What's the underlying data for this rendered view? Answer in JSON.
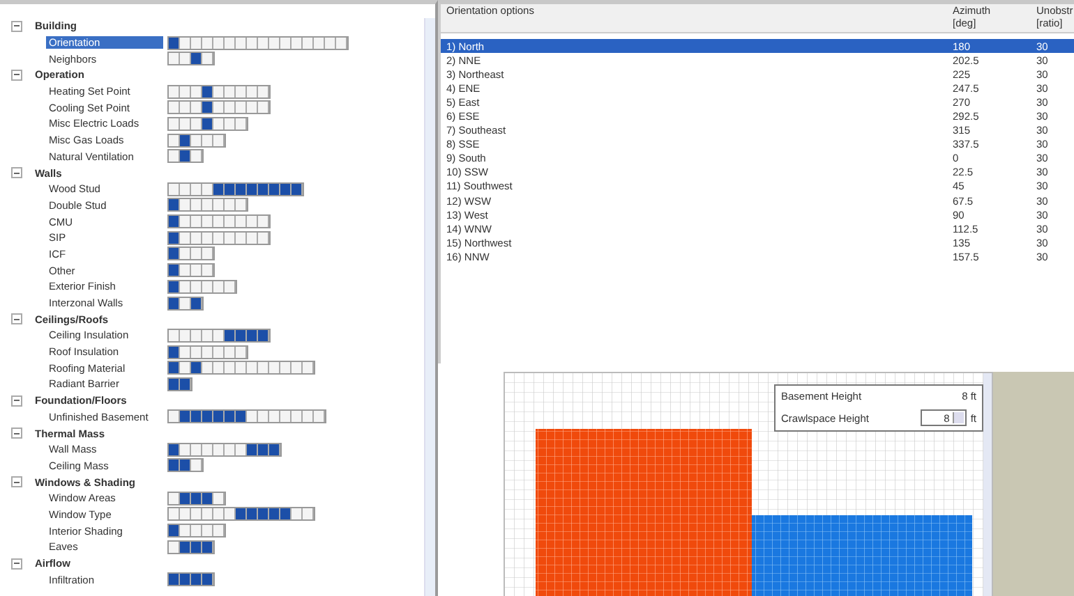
{
  "tree": {
    "groups": [
      {
        "label": "Building",
        "expanded": true,
        "items": [
          {
            "label": "Orientation",
            "selected": true,
            "options": [
              {
                "selected": true
              },
              {
                "selected": false
              },
              {
                "selected": false
              },
              {
                "selected": false
              },
              {
                "selected": false
              },
              {
                "selected": false
              },
              {
                "selected": false
              },
              {
                "selected": false
              },
              {
                "selected": false
              },
              {
                "selected": false
              },
              {
                "selected": false
              },
              {
                "selected": false
              },
              {
                "selected": false
              },
              {
                "selected": false
              },
              {
                "selected": false
              },
              {
                "selected": false
              }
            ]
          },
          {
            "label": "Neighbors",
            "selected": false,
            "options": [
              {
                "selected": false
              },
              {
                "selected": false
              },
              {
                "selected": true
              },
              {
                "selected": false
              }
            ]
          }
        ]
      },
      {
        "label": "Operation",
        "expanded": true,
        "items": [
          {
            "label": "Heating Set Point",
            "selected": false,
            "options": [
              {
                "selected": false
              },
              {
                "selected": false
              },
              {
                "selected": false
              },
              {
                "selected": true
              },
              {
                "selected": false
              },
              {
                "selected": false
              },
              {
                "selected": false
              },
              {
                "selected": false
              },
              {
                "selected": false
              }
            ]
          },
          {
            "label": "Cooling Set Point",
            "selected": false,
            "options": [
              {
                "selected": false
              },
              {
                "selected": false
              },
              {
                "selected": false
              },
              {
                "selected": true
              },
              {
                "selected": false
              },
              {
                "selected": false
              },
              {
                "selected": false
              },
              {
                "selected": false
              },
              {
                "selected": false
              }
            ]
          },
          {
            "label": "Misc Electric Loads",
            "selected": false,
            "options": [
              {
                "selected": false
              },
              {
                "selected": false
              },
              {
                "selected": false
              },
              {
                "selected": true
              },
              {
                "selected": false
              },
              {
                "selected": false
              },
              {
                "selected": false
              }
            ]
          },
          {
            "label": "Misc Gas Loads",
            "selected": false,
            "options": [
              {
                "selected": false
              },
              {
                "selected": true
              },
              {
                "selected": false
              },
              {
                "selected": false
              },
              {
                "selected": false
              }
            ]
          },
          {
            "label": "Natural Ventilation",
            "selected": false,
            "options": [
              {
                "selected": false
              },
              {
                "selected": true
              },
              {
                "selected": false
              }
            ]
          }
        ]
      },
      {
        "label": "Walls",
        "expanded": true,
        "items": [
          {
            "label": "Wood Stud",
            "selected": false,
            "options": [
              {
                "selected": false
              },
              {
                "selected": false
              },
              {
                "selected": false
              },
              {
                "selected": false
              },
              {
                "selected": true
              },
              {
                "selected": true
              },
              {
                "selected": true
              },
              {
                "selected": true
              },
              {
                "selected": true
              },
              {
                "selected": true
              },
              {
                "selected": true
              },
              {
                "selected": true
              }
            ]
          },
          {
            "label": "Double Stud",
            "selected": false,
            "options": [
              {
                "selected": true
              },
              {
                "selected": false
              },
              {
                "selected": false
              },
              {
                "selected": false
              },
              {
                "selected": false
              },
              {
                "selected": false
              },
              {
                "selected": false
              }
            ]
          },
          {
            "label": "CMU",
            "selected": false,
            "options": [
              {
                "selected": true
              },
              {
                "selected": false
              },
              {
                "selected": false
              },
              {
                "selected": false
              },
              {
                "selected": false
              },
              {
                "selected": false
              },
              {
                "selected": false
              },
              {
                "selected": false
              },
              {
                "selected": false
              }
            ]
          },
          {
            "label": "SIP",
            "selected": false,
            "options": [
              {
                "selected": true
              },
              {
                "selected": false
              },
              {
                "selected": false
              },
              {
                "selected": false
              },
              {
                "selected": false
              },
              {
                "selected": false
              },
              {
                "selected": false
              },
              {
                "selected": false
              },
              {
                "selected": false
              }
            ]
          },
          {
            "label": "ICF",
            "selected": false,
            "options": [
              {
                "selected": true
              },
              {
                "selected": false
              },
              {
                "selected": false
              },
              {
                "selected": false
              }
            ]
          },
          {
            "label": "Other",
            "selected": false,
            "options": [
              {
                "selected": true
              },
              {
                "selected": false
              },
              {
                "selected": false
              },
              {
                "selected": false
              }
            ]
          },
          {
            "label": "Exterior Finish",
            "selected": false,
            "options": [
              {
                "selected": true
              },
              {
                "selected": false
              },
              {
                "selected": false
              },
              {
                "selected": false
              },
              {
                "selected": false
              },
              {
                "selected": false
              }
            ]
          },
          {
            "label": "Interzonal Walls",
            "selected": false,
            "options": [
              {
                "selected": true
              },
              {
                "selected": false
              },
              {
                "selected": true
              }
            ]
          }
        ]
      },
      {
        "label": "Ceilings/Roofs",
        "expanded": true,
        "items": [
          {
            "label": "Ceiling Insulation",
            "selected": false,
            "options": [
              {
                "selected": false
              },
              {
                "selected": false
              },
              {
                "selected": false
              },
              {
                "selected": false
              },
              {
                "selected": false
              },
              {
                "selected": true
              },
              {
                "selected": true
              },
              {
                "selected": true
              },
              {
                "selected": true
              }
            ]
          },
          {
            "label": "Roof Insulation",
            "selected": false,
            "options": [
              {
                "selected": true
              },
              {
                "selected": false
              },
              {
                "selected": false
              },
              {
                "selected": false
              },
              {
                "selected": false
              },
              {
                "selected": false
              },
              {
                "selected": false
              }
            ]
          },
          {
            "label": "Roofing Material",
            "selected": false,
            "options": [
              {
                "selected": true
              },
              {
                "selected": false
              },
              {
                "selected": true
              },
              {
                "selected": false
              },
              {
                "selected": false
              },
              {
                "selected": false
              },
              {
                "selected": false
              },
              {
                "selected": false
              },
              {
                "selected": false
              },
              {
                "selected": false
              },
              {
                "selected": false
              },
              {
                "selected": false
              },
              {
                "selected": false
              }
            ]
          },
          {
            "label": "Radiant Barrier",
            "selected": false,
            "options": [
              {
                "selected": true
              },
              {
                "selected": true
              }
            ]
          }
        ]
      },
      {
        "label": "Foundation/Floors",
        "expanded": true,
        "items": [
          {
            "label": "Unfinished Basement",
            "selected": false,
            "options": [
              {
                "selected": false
              },
              {
                "selected": true
              },
              {
                "selected": true
              },
              {
                "selected": true
              },
              {
                "selected": true
              },
              {
                "selected": true
              },
              {
                "selected": true
              },
              {
                "selected": false
              },
              {
                "selected": false
              },
              {
                "selected": false
              },
              {
                "selected": false
              },
              {
                "selected": false
              },
              {
                "selected": false
              },
              {
                "selected": false
              }
            ]
          }
        ]
      },
      {
        "label": "Thermal Mass",
        "expanded": true,
        "items": [
          {
            "label": "Wall Mass",
            "selected": false,
            "options": [
              {
                "selected": true
              },
              {
                "selected": false
              },
              {
                "selected": false
              },
              {
                "selected": false
              },
              {
                "selected": false
              },
              {
                "selected": false
              },
              {
                "selected": false
              },
              {
                "selected": true
              },
              {
                "selected": true
              },
              {
                "selected": true
              }
            ]
          },
          {
            "label": "Ceiling Mass",
            "selected": false,
            "options": [
              {
                "selected": true
              },
              {
                "selected": true
              },
              {
                "selected": false
              }
            ]
          }
        ]
      },
      {
        "label": "Windows & Shading",
        "expanded": true,
        "items": [
          {
            "label": "Window Areas",
            "selected": false,
            "options": [
              {
                "selected": false
              },
              {
                "selected": true
              },
              {
                "selected": true
              },
              {
                "selected": true
              },
              {
                "selected": false
              }
            ]
          },
          {
            "label": "Window Type",
            "selected": false,
            "options": [
              {
                "selected": false
              },
              {
                "selected": false
              },
              {
                "selected": false
              },
              {
                "selected": false
              },
              {
                "selected": false
              },
              {
                "selected": false
              },
              {
                "selected": true
              },
              {
                "selected": true
              },
              {
                "selected": true
              },
              {
                "selected": true
              },
              {
                "selected": true
              },
              {
                "selected": false
              },
              {
                "selected": false
              }
            ]
          },
          {
            "label": "Interior Shading",
            "selected": false,
            "options": [
              {
                "selected": true
              },
              {
                "selected": false
              },
              {
                "selected": false
              },
              {
                "selected": false
              },
              {
                "selected": false
              }
            ]
          },
          {
            "label": "Eaves",
            "selected": false,
            "options": [
              {
                "selected": false
              },
              {
                "selected": true
              },
              {
                "selected": true
              },
              {
                "selected": true
              }
            ]
          }
        ]
      },
      {
        "label": "Airflow",
        "expanded": true,
        "items": [
          {
            "label": "Infiltration",
            "selected": false,
            "options": [
              {
                "selected": true
              },
              {
                "selected": true
              },
              {
                "selected": true
              },
              {
                "selected": true
              }
            ]
          }
        ]
      }
    ]
  },
  "options_table": {
    "columns": [
      {
        "label": "Orientation options"
      },
      {
        "label": "Azimuth",
        "unit": "[deg]"
      },
      {
        "label": "Unobstr",
        "unit": "[ratio]"
      }
    ],
    "rows": [
      {
        "cells": [
          "1) North",
          "180",
          "30"
        ],
        "selected": true
      },
      {
        "cells": [
          "2) NNE",
          "202.5",
          "30"
        ],
        "selected": false
      },
      {
        "cells": [
          "3) Northeast",
          "225",
          "30"
        ],
        "selected": false
      },
      {
        "cells": [
          "4) ENE",
          "247.5",
          "30"
        ],
        "selected": false
      },
      {
        "cells": [
          "5) East",
          "270",
          "30"
        ],
        "selected": false
      },
      {
        "cells": [
          "6) ESE",
          "292.5",
          "30"
        ],
        "selected": false
      },
      {
        "cells": [
          "7) Southeast",
          "315",
          "30"
        ],
        "selected": false
      },
      {
        "cells": [
          "8) SSE",
          "337.5",
          "30"
        ],
        "selected": false
      },
      {
        "cells": [
          "9) South",
          "0",
          "30"
        ],
        "selected": false
      },
      {
        "cells": [
          "10) SSW",
          "22.5",
          "30"
        ],
        "selected": false
      },
      {
        "cells": [
          "11) Southwest",
          "45",
          "30"
        ],
        "selected": false
      },
      {
        "cells": [
          "12) WSW",
          "67.5",
          "30"
        ],
        "selected": false
      },
      {
        "cells": [
          "13) West",
          "90",
          "30"
        ],
        "selected": false
      },
      {
        "cells": [
          "14) WNW",
          "112.5",
          "30"
        ],
        "selected": false
      },
      {
        "cells": [
          "15) Northwest",
          "135",
          "30"
        ],
        "selected": false
      },
      {
        "cells": [
          "16) NNW",
          "157.5",
          "30"
        ],
        "selected": false
      }
    ]
  },
  "height_panel": {
    "basement_label": "Basement Height",
    "basement_value": "8 ft",
    "crawlspace_label": "Crawlspace Height",
    "crawlspace_value": "8",
    "crawlspace_unit": "ft"
  }
}
